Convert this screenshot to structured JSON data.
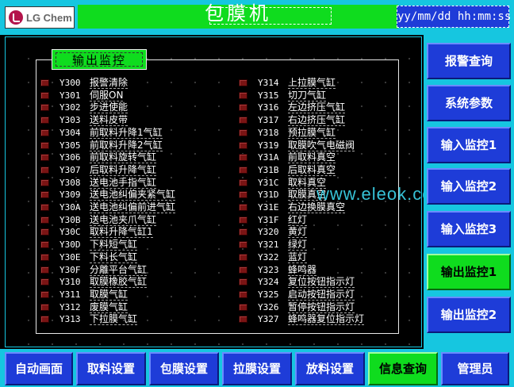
{
  "header": {
    "logo_text": "LG Chem",
    "title": "包膜机",
    "datetime": "yy/mm/dd hh:mm:ss"
  },
  "panel": {
    "group_title": "输出监控",
    "watermark": "www.eleok.com",
    "left_column": [
      {
        "addr": "Y300",
        "desc": "报警清除"
      },
      {
        "addr": "Y301",
        "desc": "伺服ON"
      },
      {
        "addr": "Y302",
        "desc": "步进使能"
      },
      {
        "addr": "Y303",
        "desc": "送料皮带"
      },
      {
        "addr": "Y304",
        "desc": "前取料升降1气缸"
      },
      {
        "addr": "Y305",
        "desc": "前取料升降2气缸"
      },
      {
        "addr": "Y306",
        "desc": "前取料旋转气缸"
      },
      {
        "addr": "Y307",
        "desc": "后取料升降气缸"
      },
      {
        "addr": "Y308",
        "desc": "送电池手指气缸"
      },
      {
        "addr": "Y309",
        "desc": "送电池纠偏夹紧气缸"
      },
      {
        "addr": "Y30A",
        "desc": "送电池纠偏前进气缸"
      },
      {
        "addr": "Y30B",
        "desc": "送电池夹爪气缸"
      },
      {
        "addr": "Y30C",
        "desc": "取料升降气缸1"
      },
      {
        "addr": "Y30D",
        "desc": "下料短气缸"
      },
      {
        "addr": "Y30E",
        "desc": "下料长气缸"
      },
      {
        "addr": "Y30F",
        "desc": "分離平台气缸"
      },
      {
        "addr": "Y310",
        "desc": "取膜橡胶气缸"
      },
      {
        "addr": "Y311",
        "desc": "取膜气缸"
      },
      {
        "addr": "Y312",
        "desc": "废膜气缸"
      },
      {
        "addr": "Y313",
        "desc": "下拉膜气缸"
      }
    ],
    "right_column": [
      {
        "addr": "Y314",
        "desc": "上拉膜气缸"
      },
      {
        "addr": "Y315",
        "desc": "切刀气缸"
      },
      {
        "addr": "Y316",
        "desc": "左边挤压气缸"
      },
      {
        "addr": "Y317",
        "desc": "右边挤压气缸"
      },
      {
        "addr": "Y318",
        "desc": "预拉膜气缸"
      },
      {
        "addr": "Y319",
        "desc": "取膜吹气电磁阀"
      },
      {
        "addr": "Y31A",
        "desc": "前取料真空"
      },
      {
        "addr": "Y31B",
        "desc": "后取料真空"
      },
      {
        "addr": "Y31C",
        "desc": "取料真空"
      },
      {
        "addr": "Y31D",
        "desc": "取膜真空"
      },
      {
        "addr": "Y31E",
        "desc": "右边换膜真空"
      },
      {
        "addr": "Y31F",
        "desc": "红灯"
      },
      {
        "addr": "Y320",
        "desc": "黄灯"
      },
      {
        "addr": "Y321",
        "desc": "绿灯"
      },
      {
        "addr": "Y322",
        "desc": "蓝灯"
      },
      {
        "addr": "Y323",
        "desc": "蜂鸣器"
      },
      {
        "addr": "Y324",
        "desc": "复位按钮指示灯"
      },
      {
        "addr": "Y325",
        "desc": "启动按钮指示灯"
      },
      {
        "addr": "Y326",
        "desc": "暂停按钮指示灯"
      },
      {
        "addr": "Y327",
        "desc": "蜂鸣器复位指示灯"
      }
    ]
  },
  "sidebar": {
    "items": [
      {
        "label": "报警查询"
      },
      {
        "label": "系统参数"
      },
      {
        "label": "输入监控1"
      },
      {
        "label": "输入监控2"
      },
      {
        "label": "输入监控3"
      },
      {
        "label": "输出监控1"
      },
      {
        "label": "输出监控2"
      }
    ],
    "active_index": 5
  },
  "bottombar": {
    "items": [
      {
        "label": "自动画面"
      },
      {
        "label": "取料设置"
      },
      {
        "label": "包膜设置"
      },
      {
        "label": "拉膜设置"
      },
      {
        "label": "放料设置"
      },
      {
        "label": "信息查询"
      },
      {
        "label": "管理员"
      }
    ],
    "active_index": 5
  },
  "colors": {
    "accent_cyan": "#16c6e0",
    "button_blue": "#1e3cd8",
    "active_green": "#0fdc1e",
    "lamp_off": "#7a1414"
  }
}
